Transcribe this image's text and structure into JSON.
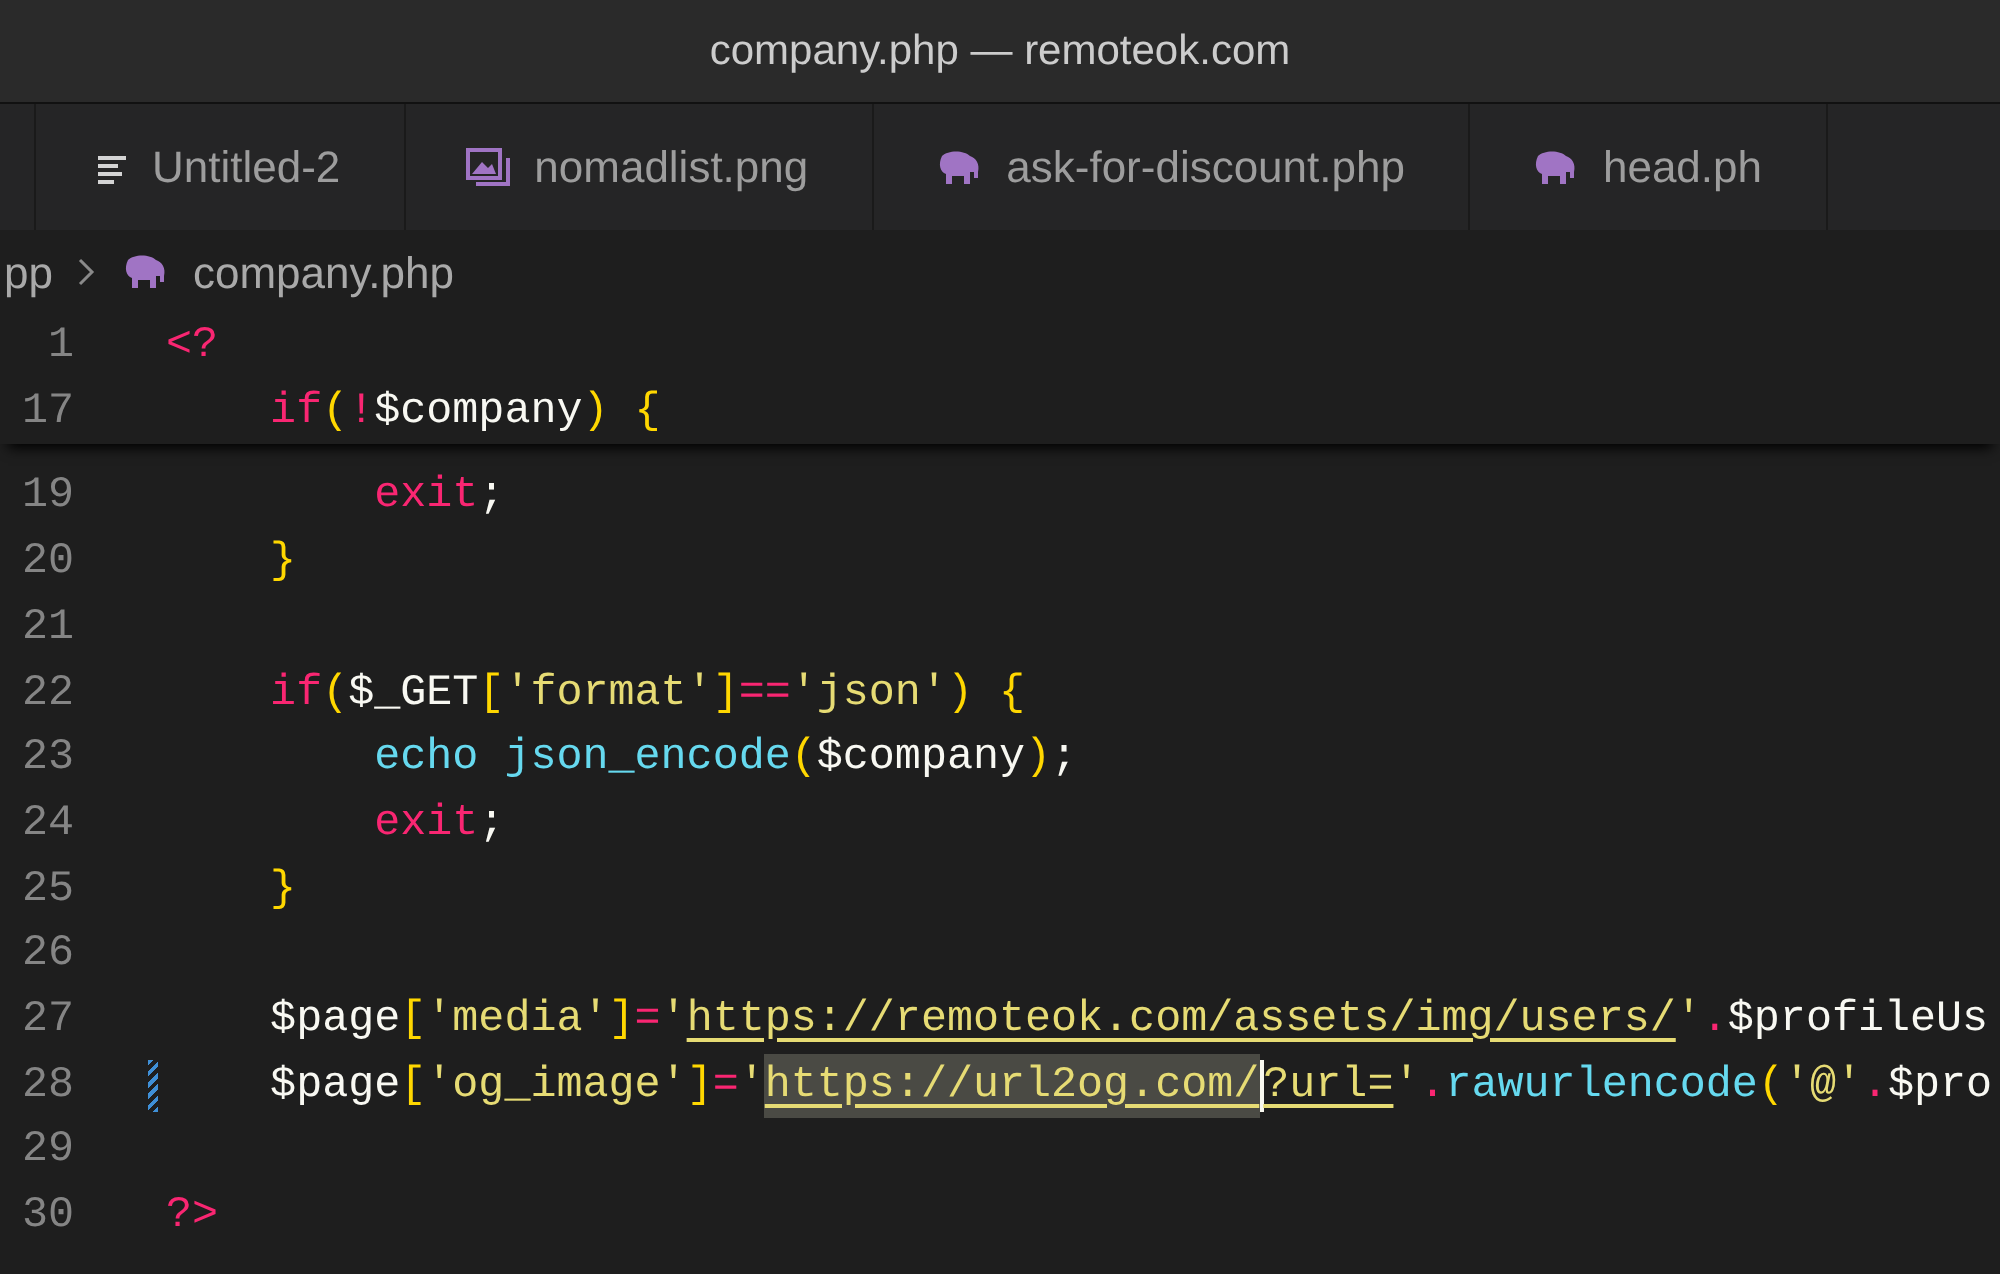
{
  "window": {
    "title": "company.php — remoteok.com"
  },
  "tabs": [
    {
      "label": "Untitled-2",
      "kind": "text",
      "selected": false
    },
    {
      "label": "nomadlist.png",
      "kind": "image",
      "selected": false
    },
    {
      "label": "ask-for-discount.php",
      "kind": "php",
      "selected": false
    },
    {
      "label": "head.ph",
      "kind": "php",
      "selected": false
    }
  ],
  "breadcrumb": [
    {
      "label": "pp",
      "kind": "folder"
    },
    {
      "label": "company.php",
      "kind": "php"
    }
  ],
  "sticky_lines": [
    {
      "number": "1",
      "tokens": [
        {
          "text": "<?",
          "kind": "keyword"
        }
      ]
    },
    {
      "number": "17",
      "tokens": [
        {
          "text": "    if",
          "kind": "keyword"
        },
        {
          "text": "(",
          "kind": "bracket"
        },
        {
          "text": "!",
          "kind": "keyword"
        },
        {
          "text": "$company",
          "kind": "var"
        },
        {
          "text": ")",
          "kind": "bracket"
        },
        {
          "text": " {",
          "kind": "bracket"
        }
      ]
    }
  ],
  "lines": [
    {
      "number": "19",
      "modified": false,
      "tokens": [
        {
          "text": "        exit",
          "kind": "keyword"
        },
        {
          "text": ";",
          "kind": "punct"
        }
      ]
    },
    {
      "number": "20",
      "modified": false,
      "tokens": [
        {
          "text": "    }",
          "kind": "bracket"
        }
      ]
    },
    {
      "number": "21",
      "modified": false
    },
    {
      "number": "22",
      "modified": false,
      "tokens": [
        {
          "text": "    if",
          "kind": "keyword"
        },
        {
          "text": "(",
          "kind": "bracket"
        },
        {
          "text": "$_GET",
          "kind": "var"
        },
        {
          "text": "[",
          "kind": "bracket"
        },
        {
          "text": "'format'",
          "kind": "string"
        },
        {
          "text": "]",
          "kind": "bracket"
        },
        {
          "text": "==",
          "kind": "keyword"
        },
        {
          "text": "'json'",
          "kind": "string"
        },
        {
          "text": ")",
          "kind": "bracket"
        },
        {
          "text": " {",
          "kind": "bracket"
        }
      ]
    },
    {
      "number": "23",
      "modified": false,
      "tokens": [
        {
          "text": "        echo",
          "kind": "func"
        },
        {
          "text": " json_encode",
          "kind": "func"
        },
        {
          "text": "(",
          "kind": "bracket"
        },
        {
          "text": "$company",
          "kind": "var"
        },
        {
          "text": ")",
          "kind": "bracket"
        },
        {
          "text": ";",
          "kind": "punct"
        }
      ]
    },
    {
      "number": "24",
      "modified": false,
      "tokens": [
        {
          "text": "        exit",
          "kind": "keyword"
        },
        {
          "text": ";",
          "kind": "punct"
        }
      ]
    },
    {
      "number": "25",
      "modified": false,
      "tokens": [
        {
          "text": "    }",
          "kind": "bracket"
        }
      ]
    },
    {
      "number": "26",
      "modified": false
    },
    {
      "number": "27",
      "modified": false,
      "tokens": [
        {
          "text": "    $page",
          "kind": "var"
        },
        {
          "text": "[",
          "kind": "bracket"
        },
        {
          "text": "'media'",
          "kind": "string"
        },
        {
          "text": "]",
          "kind": "bracket"
        },
        {
          "text": "=",
          "kind": "keyword"
        },
        {
          "text": "'",
          "kind": "string"
        },
        {
          "text": "https://remoteok.com/assets/img/users/",
          "kind": "link"
        },
        {
          "text": "'",
          "kind": "string"
        },
        {
          "text": ".",
          "kind": "keyword"
        },
        {
          "text": "$profileUs",
          "kind": "var"
        }
      ]
    },
    {
      "number": "28",
      "modified": true,
      "tokens": [
        {
          "text": "    $page",
          "kind": "var"
        },
        {
          "text": "[",
          "kind": "bracket"
        },
        {
          "text": "'og_image'",
          "kind": "string"
        },
        {
          "text": "]",
          "kind": "bracket"
        },
        {
          "text": "=",
          "kind": "keyword"
        },
        {
          "text": "'",
          "kind": "string"
        },
        {
          "text": "https://url2og.com/",
          "kind": "link",
          "highlighted": true
        },
        {
          "text": "?url=",
          "kind": "link",
          "cursor": true
        },
        {
          "text": "'",
          "kind": "string"
        },
        {
          "text": ".",
          "kind": "keyword"
        },
        {
          "text": "rawurlencode",
          "kind": "func"
        },
        {
          "text": "(",
          "kind": "bracket"
        },
        {
          "text": "'@'",
          "kind": "string"
        },
        {
          "text": ".",
          "kind": "keyword"
        },
        {
          "text": "$pro",
          "kind": "var"
        }
      ]
    },
    {
      "number": "29",
      "modified": false
    },
    {
      "number": "30",
      "modified": false,
      "tokens": [
        {
          "text": "?>",
          "kind": "keyword"
        }
      ]
    }
  ]
}
